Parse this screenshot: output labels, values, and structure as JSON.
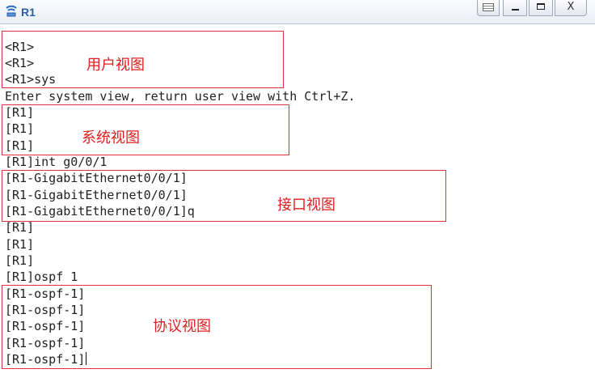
{
  "window": {
    "title": "R1",
    "buttons": {
      "minimize": "−",
      "maximize": "□",
      "close": "X"
    }
  },
  "terminal": {
    "lines": [
      "<R1>",
      "<R1>",
      "<R1>sys",
      "Enter system view, return user view with Ctrl+Z.",
      "[R1]",
      "[R1]",
      "[R1]",
      "[R1]int g0/0/1",
      "[R1-GigabitEthernet0/0/1]",
      "[R1-GigabitEthernet0/0/1]",
      "[R1-GigabitEthernet0/0/1]q",
      "[R1]",
      "[R1]",
      "[R1]",
      "[R1]ospf 1",
      "[R1-ospf-1]",
      "[R1-ospf-1]",
      "[R1-ospf-1]",
      "[R1-ospf-1]",
      "[R1-ospf-1]"
    ]
  },
  "annotations": {
    "user_view": "用户视图",
    "system_view": "系统视图",
    "interface_view": "接口视图",
    "protocol_view": "协议视图"
  },
  "colors": {
    "annotation": "#e02020",
    "title_text": "#2a5fa3",
    "terminal_text": "#222222"
  }
}
